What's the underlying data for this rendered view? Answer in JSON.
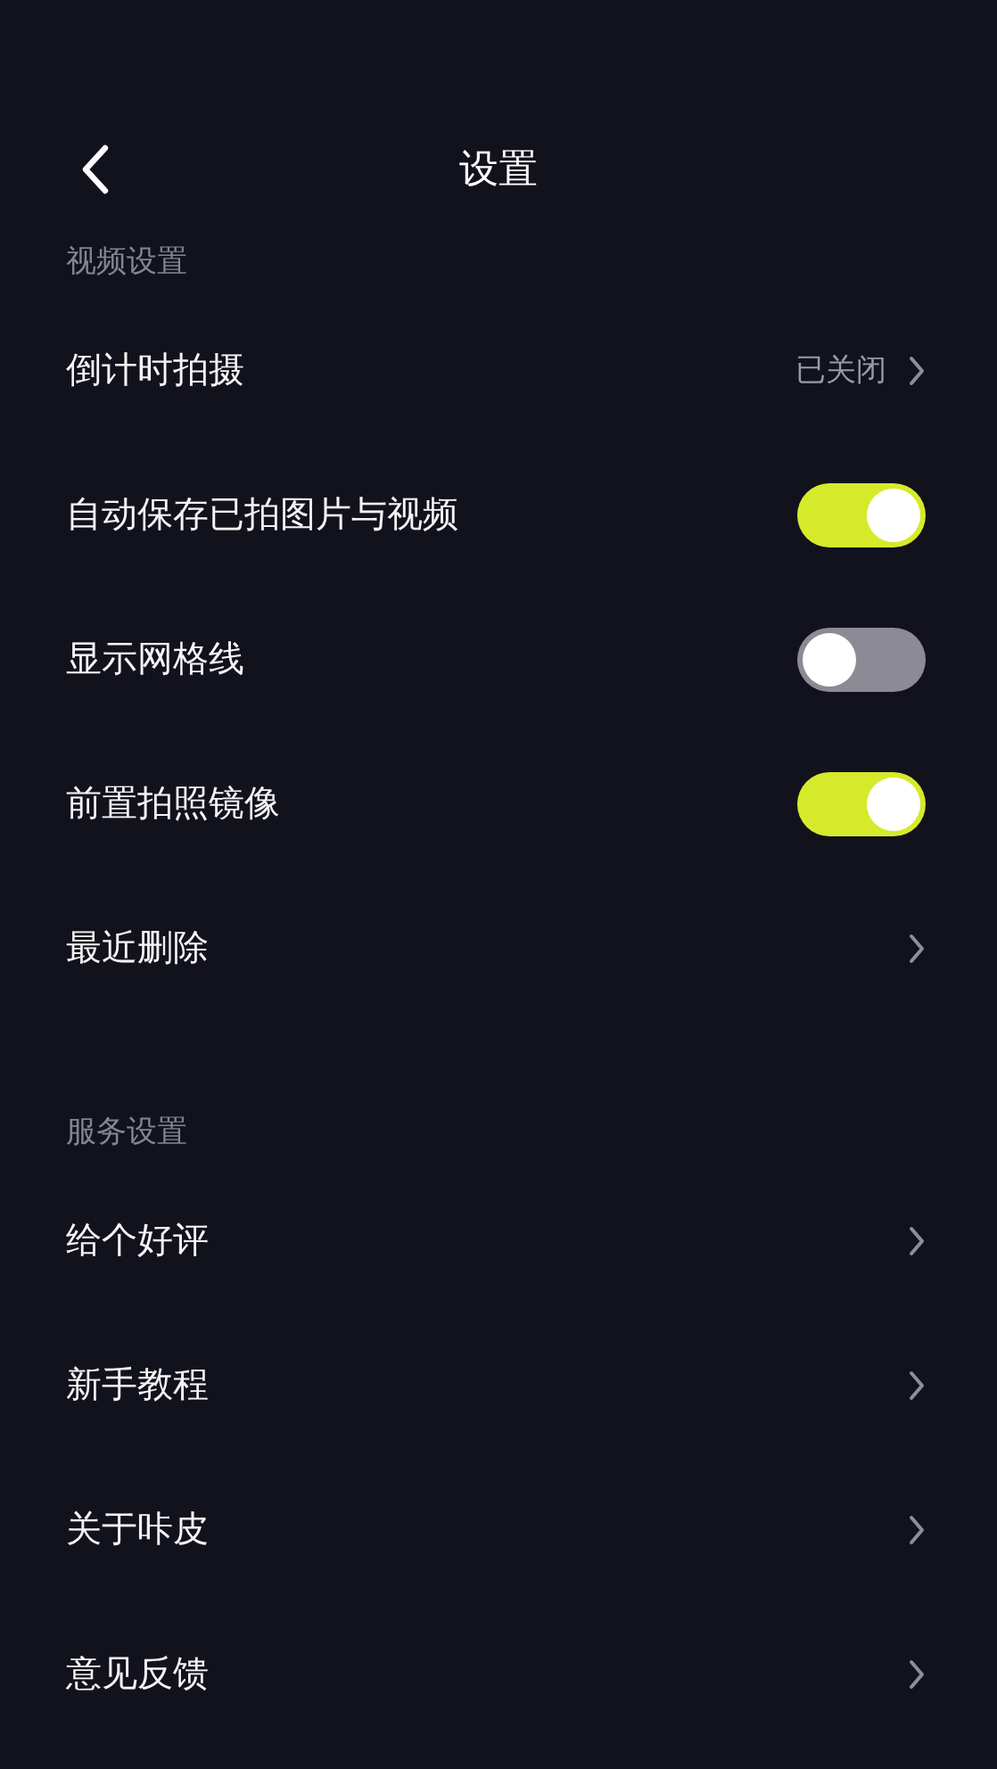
{
  "header": {
    "title": "设置"
  },
  "sections": [
    {
      "title": "视频设置",
      "items": [
        {
          "kind": "link",
          "label": "倒计时拍摄",
          "value": "已关闭"
        },
        {
          "kind": "toggle",
          "label": "自动保存已拍图片与视频",
          "on": true
        },
        {
          "kind": "toggle",
          "label": "显示网格线",
          "on": false
        },
        {
          "kind": "toggle",
          "label": "前置拍照镜像",
          "on": true
        },
        {
          "kind": "link",
          "label": "最近删除"
        }
      ]
    },
    {
      "title": "服务设置",
      "items": [
        {
          "kind": "link",
          "label": "给个好评"
        },
        {
          "kind": "link",
          "label": "新手教程"
        },
        {
          "kind": "link",
          "label": "关于咔皮"
        },
        {
          "kind": "link",
          "label": "意见反馈"
        }
      ]
    }
  ]
}
